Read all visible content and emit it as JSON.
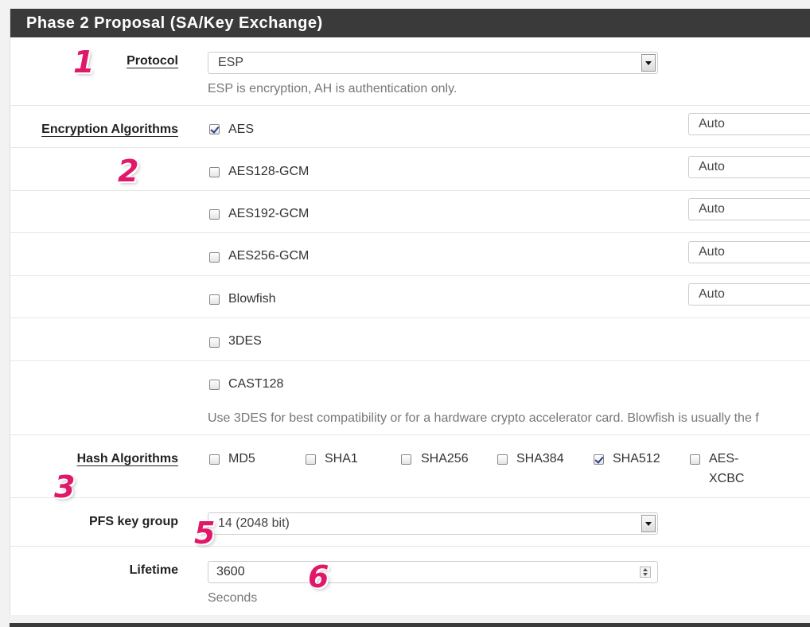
{
  "panel": {
    "title": "Phase 2 Proposal (SA/Key Exchange)"
  },
  "protocol": {
    "label": "Protocol",
    "value": "ESP",
    "help": "ESP is encryption, AH is authentication only."
  },
  "encryption": {
    "label": "Encryption Algorithms",
    "items": [
      {
        "name": "AES",
        "checked": true,
        "keylen": "Auto"
      },
      {
        "name": "AES128-GCM",
        "checked": false,
        "keylen": "Auto"
      },
      {
        "name": "AES192-GCM",
        "checked": false,
        "keylen": "Auto"
      },
      {
        "name": "AES256-GCM",
        "checked": false,
        "keylen": "Auto"
      },
      {
        "name": "Blowfish",
        "checked": false,
        "keylen": "Auto"
      },
      {
        "name": "3DES",
        "checked": false
      },
      {
        "name": "CAST128",
        "checked": false
      }
    ],
    "help": "Use 3DES for best compatibility or for a hardware crypto accelerator card. Blowfish is usually the f"
  },
  "hash": {
    "label": "Hash Algorithms",
    "items": [
      {
        "name": "MD5",
        "checked": false
      },
      {
        "name": "SHA1",
        "checked": false
      },
      {
        "name": "SHA256",
        "checked": false
      },
      {
        "name": "SHA384",
        "checked": false
      },
      {
        "name": "SHA512",
        "checked": true
      },
      {
        "name": "AES-",
        "name2": "XCBC",
        "checked": false
      }
    ]
  },
  "pfs": {
    "label": "PFS key group",
    "value": "14 (2048 bit)"
  },
  "lifetime": {
    "label": "Lifetime",
    "value": "3600",
    "help": "Seconds"
  },
  "annotations": [
    "1",
    "2",
    "3",
    "5",
    "6"
  ]
}
